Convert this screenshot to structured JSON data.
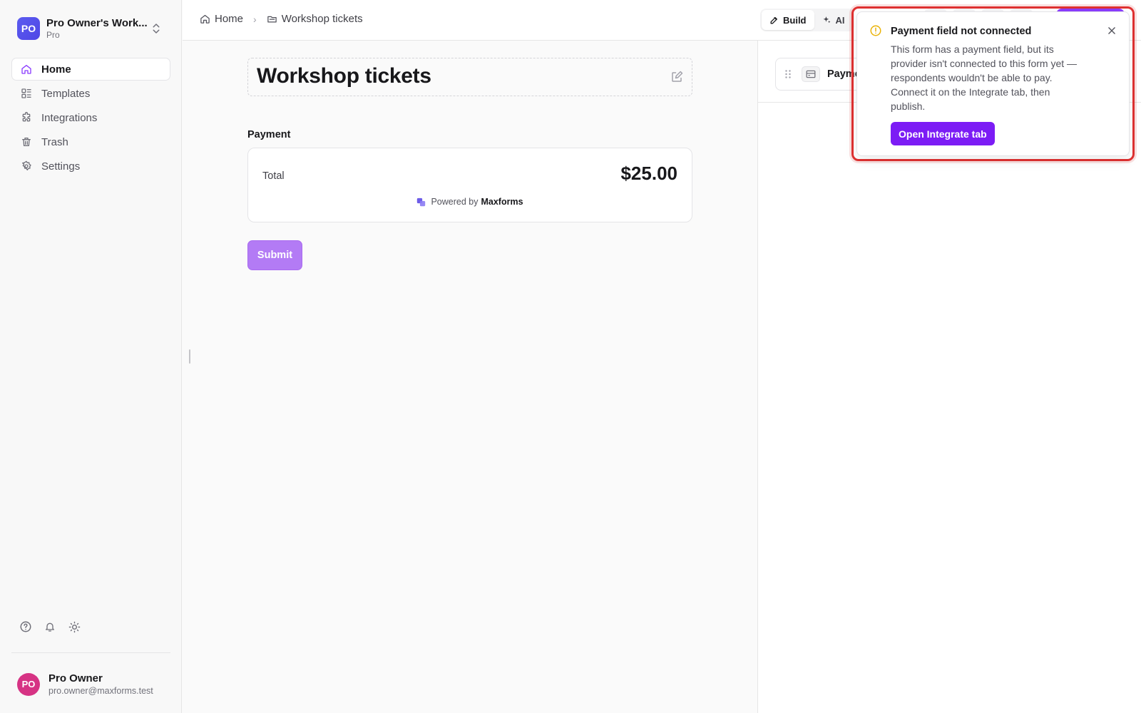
{
  "workspace": {
    "initials": "PO",
    "name": "Pro Owner's Work...",
    "plan": "Pro"
  },
  "sidebar": {
    "items": [
      {
        "label": "Home",
        "icon": "home-icon",
        "active": true
      },
      {
        "label": "Templates",
        "icon": "templates-icon"
      },
      {
        "label": "Integrations",
        "icon": "puzzle-icon"
      },
      {
        "label": "Trash",
        "icon": "trash-icon"
      },
      {
        "label": "Settings",
        "icon": "gear-icon"
      }
    ],
    "tools": [
      "help-icon",
      "bell-icon",
      "sun-icon"
    ]
  },
  "user": {
    "initials": "PO",
    "name": "Pro Owner",
    "email": "pro.owner@maxforms.test"
  },
  "breadcrumb": {
    "home": "Home",
    "current": "Workshop tickets"
  },
  "mode_tabs": [
    {
      "label": "Build",
      "icon": "pencil-icon",
      "active": true
    },
    {
      "label": "AI",
      "icon": "sparkles-icon"
    }
  ],
  "form": {
    "title": "Workshop tickets",
    "payment_label": "Payment",
    "total_label": "Total",
    "total_amount": "$25.00",
    "powered_by_prefix": "Powered by",
    "powered_by_brand": "Maxforms",
    "submit_label": "Submit"
  },
  "right_panel": {
    "field_label": "Payme"
  },
  "toast": {
    "title": "Payment field not connected",
    "body": "This form has a payment field, but its provider isn't connected to this form yet — respondents wouldn't be able to pay. Connect it on the Integrate tab, then publish.",
    "action_label": "Open Integrate tab"
  },
  "colors": {
    "accent": "#7c1cf5",
    "submit_disabled": "#b37bf5",
    "warning": "#eab308",
    "highlight_outline": "#e03131",
    "workspace_avatar": "#4f46e5",
    "user_avatar": "#d63384"
  }
}
